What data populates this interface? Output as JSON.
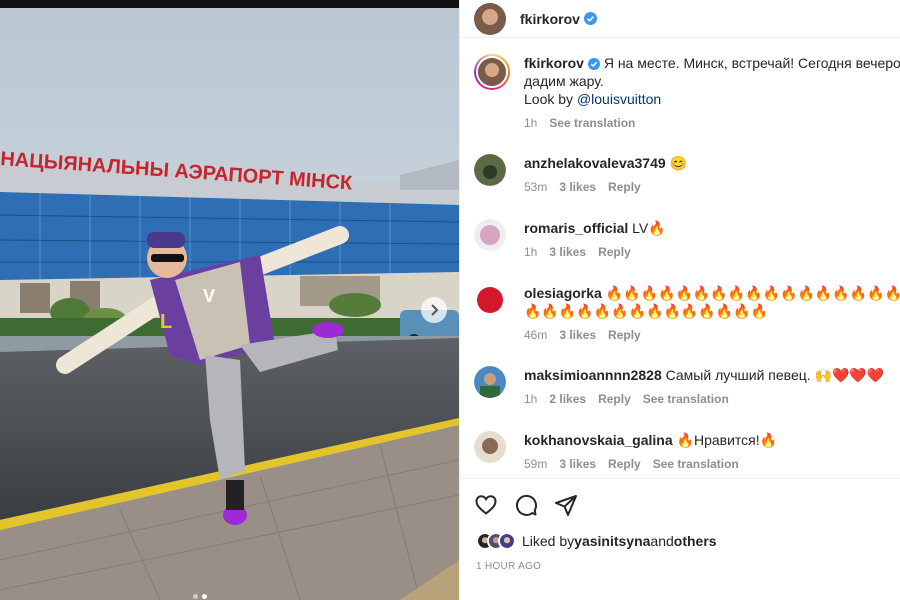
{
  "post_author": {
    "username": "fkirkorov",
    "verified": true
  },
  "photo": {
    "sign_text": "НАЦЫЯНАЛЬНЫ АЭРАПОРТ МІНСК",
    "carousel_index": 2,
    "carousel_total": 2
  },
  "caption": {
    "username": "fkirkorov",
    "text_line1": "Я на месте. Минск, встречай! Сегодня вечером",
    "text_line2": "дадим жару.",
    "look_by": "Look by ",
    "mention": "@louisvuitton",
    "time": "1h",
    "see_translation": "See translation"
  },
  "comments": [
    {
      "username": "anzhelakovaleva3749",
      "text": "😊",
      "time": "53m",
      "likes": "3 likes",
      "reply": "Reply",
      "translation": ""
    },
    {
      "username": "romaris_official",
      "text": "LV🔥",
      "time": "1h",
      "likes": "3 likes",
      "reply": "Reply",
      "translation": ""
    },
    {
      "username": "olesiagorka",
      "text": "🔥🔥🔥🔥🔥🔥🔥🔥🔥🔥🔥🔥🔥🔥🔥🔥🔥🔥🔥🔥",
      "text2": "🔥🔥🔥🔥🔥🔥🔥🔥🔥🔥🔥🔥🔥🔥",
      "time": "46m",
      "likes": "3 likes",
      "reply": "Reply",
      "translation": ""
    },
    {
      "username": "maksimioannnn2828",
      "text": "Самый лучший певец. 🙌❤️❤️❤️",
      "time": "1h",
      "likes": "2 likes",
      "reply": "Reply",
      "translation": "See translation"
    },
    {
      "username": "kokhanovskaia_galina",
      "text": "🔥Нравится!🔥",
      "time": "59m",
      "likes": "3 likes",
      "reply": "Reply",
      "translation": "See translation"
    }
  ],
  "liked_by": {
    "prefix": "Liked by ",
    "user": "yasinitsyna",
    "mid": " and ",
    "others": "others"
  },
  "post_time": "1 HOUR AGO",
  "icons": [
    "heart-icon",
    "comment-icon",
    "share-icon",
    "verified-icon",
    "chevron-right-icon"
  ],
  "colors": {
    "verified": "#3897f0",
    "link": "#00376b",
    "muted": "#8e8e8e"
  }
}
